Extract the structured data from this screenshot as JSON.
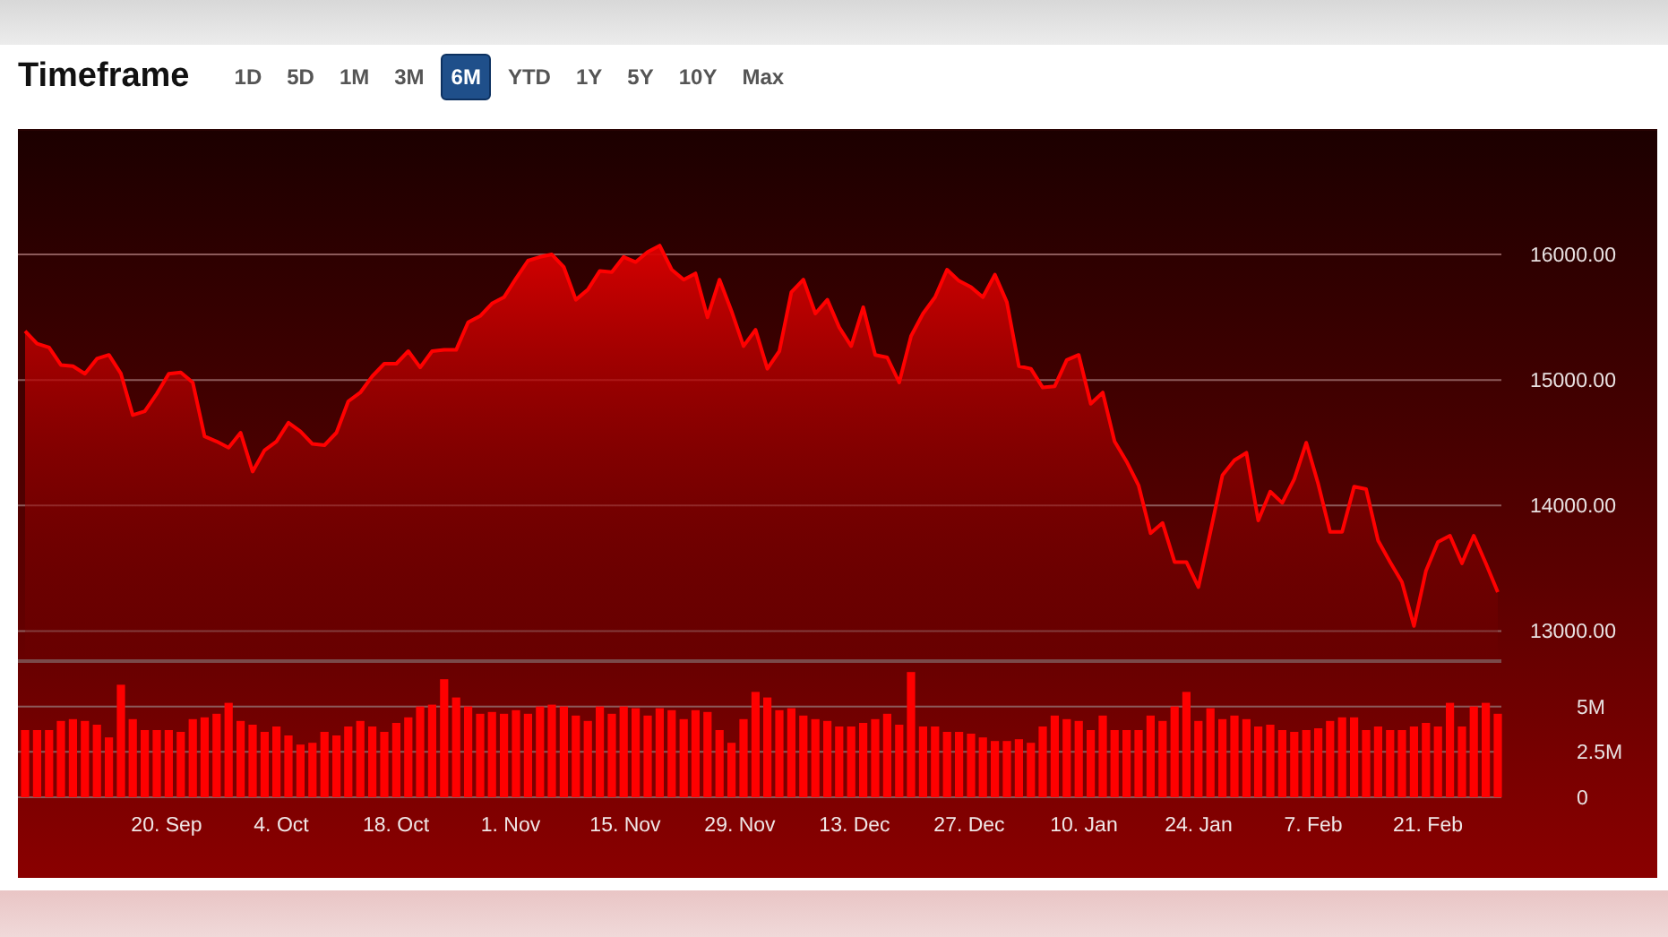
{
  "header": {
    "title": "Timeframe",
    "ranges": [
      {
        "label": "1D",
        "selected": false
      },
      {
        "label": "5D",
        "selected": false
      },
      {
        "label": "1M",
        "selected": false
      },
      {
        "label": "3M",
        "selected": false
      },
      {
        "label": "6M",
        "selected": true
      },
      {
        "label": "YTD",
        "selected": false
      },
      {
        "label": "1Y",
        "selected": false
      },
      {
        "label": "5Y",
        "selected": false
      },
      {
        "label": "10Y",
        "selected": false
      },
      {
        "label": "Max",
        "selected": false
      }
    ]
  },
  "price_chart": {
    "chart_data": {
      "type": "area",
      "grid": true,
      "ylim": [
        12760,
        17000
      ],
      "yticks": [
        {
          "value": 13000,
          "label": "13000.00"
        },
        {
          "value": 14000,
          "label": "14000.00"
        },
        {
          "value": 15000,
          "label": "15000.00"
        },
        {
          "value": 16000,
          "label": "16000.00"
        }
      ],
      "values": [
        15390,
        15290,
        15260,
        15120,
        15110,
        15050,
        15170,
        15200,
        15050,
        14720,
        14750,
        14890,
        15050,
        15060,
        14980,
        14550,
        14510,
        14460,
        14580,
        14270,
        14440,
        14510,
        14660,
        14590,
        14490,
        14480,
        14580,
        14830,
        14900,
        15030,
        15130,
        15130,
        15230,
        15100,
        15230,
        15240,
        15240,
        15460,
        15510,
        15610,
        15660,
        15810,
        15950,
        15980,
        16000,
        15900,
        15640,
        15720,
        15870,
        15860,
        15980,
        15940,
        16020,
        16070,
        15880,
        15800,
        15850,
        15500,
        15800,
        15550,
        15270,
        15400,
        15090,
        15230,
        15700,
        15800,
        15530,
        15640,
        15420,
        15270,
        15580,
        15200,
        15180,
        14980,
        15350,
        15530,
        15660,
        15880,
        15790,
        15740,
        15660,
        15840,
        15620,
        15110,
        15090,
        14940,
        14950,
        15160,
        15200,
        14810,
        14900,
        14510,
        14350,
        14160,
        13780,
        13860,
        13550,
        13550,
        13350,
        13790,
        14240,
        14360,
        14420,
        13880,
        14110,
        14020,
        14210,
        14500,
        14170,
        13790,
        13790,
        14150,
        14130,
        13720,
        13550,
        13390,
        13040,
        13480,
        13710,
        13760,
        13540,
        13760,
        13540,
        13310
      ]
    }
  },
  "volume_chart": {
    "chart_data": {
      "type": "bar",
      "grid": true,
      "ylim": [
        0,
        7.5
      ],
      "yticks": [
        {
          "value": 0,
          "label": "0"
        },
        {
          "value": 2.5,
          "label": "2.5M"
        },
        {
          "value": 5,
          "label": "5M"
        }
      ],
      "values": [
        3.7,
        3.7,
        3.7,
        4.2,
        4.3,
        4.2,
        4.0,
        3.3,
        6.2,
        4.3,
        3.7,
        3.7,
        3.7,
        3.6,
        4.3,
        4.4,
        4.6,
        5.2,
        4.2,
        4.0,
        3.6,
        3.9,
        3.4,
        2.9,
        3.0,
        3.6,
        3.4,
        3.9,
        4.2,
        3.9,
        3.6,
        4.1,
        4.4,
        5.0,
        5.1,
        6.5,
        5.5,
        5.0,
        4.6,
        4.7,
        4.6,
        4.8,
        4.6,
        5.0,
        5.1,
        5.0,
        4.5,
        4.2,
        5.0,
        4.6,
        5.0,
        4.9,
        4.5,
        4.9,
        4.8,
        4.3,
        4.8,
        4.7,
        3.7,
        3.0,
        4.3,
        5.8,
        5.5,
        4.8,
        4.9,
        4.5,
        4.3,
        4.2,
        3.9,
        3.9,
        4.1,
        4.3,
        4.6,
        4.0,
        6.9,
        3.9,
        3.9,
        3.6,
        3.6,
        3.5,
        3.3,
        3.1,
        3.1,
        3.2,
        3.0,
        3.9,
        4.5,
        4.3,
        4.2,
        3.7,
        4.5,
        3.7,
        3.7,
        3.7,
        4.5,
        4.2,
        5.0,
        5.8,
        4.2,
        4.9,
        4.3,
        4.5,
        4.3,
        3.9,
        4.0,
        3.7,
        3.6,
        3.7,
        3.8,
        4.2,
        4.4,
        4.4,
        3.7,
        3.9,
        3.7,
        3.7,
        3.9,
        4.1,
        3.9,
        5.2,
        3.9,
        5.0,
        5.2,
        4.6
      ]
    },
    "date_labels": [
      "20. Sep",
      "4. Oct",
      "18. Oct",
      "1. Nov",
      "15. Nov",
      "29. Nov",
      "13. Dec",
      "27. Dec",
      "10. Jan",
      "24. Jan",
      "7. Feb",
      "21. Feb"
    ]
  }
}
